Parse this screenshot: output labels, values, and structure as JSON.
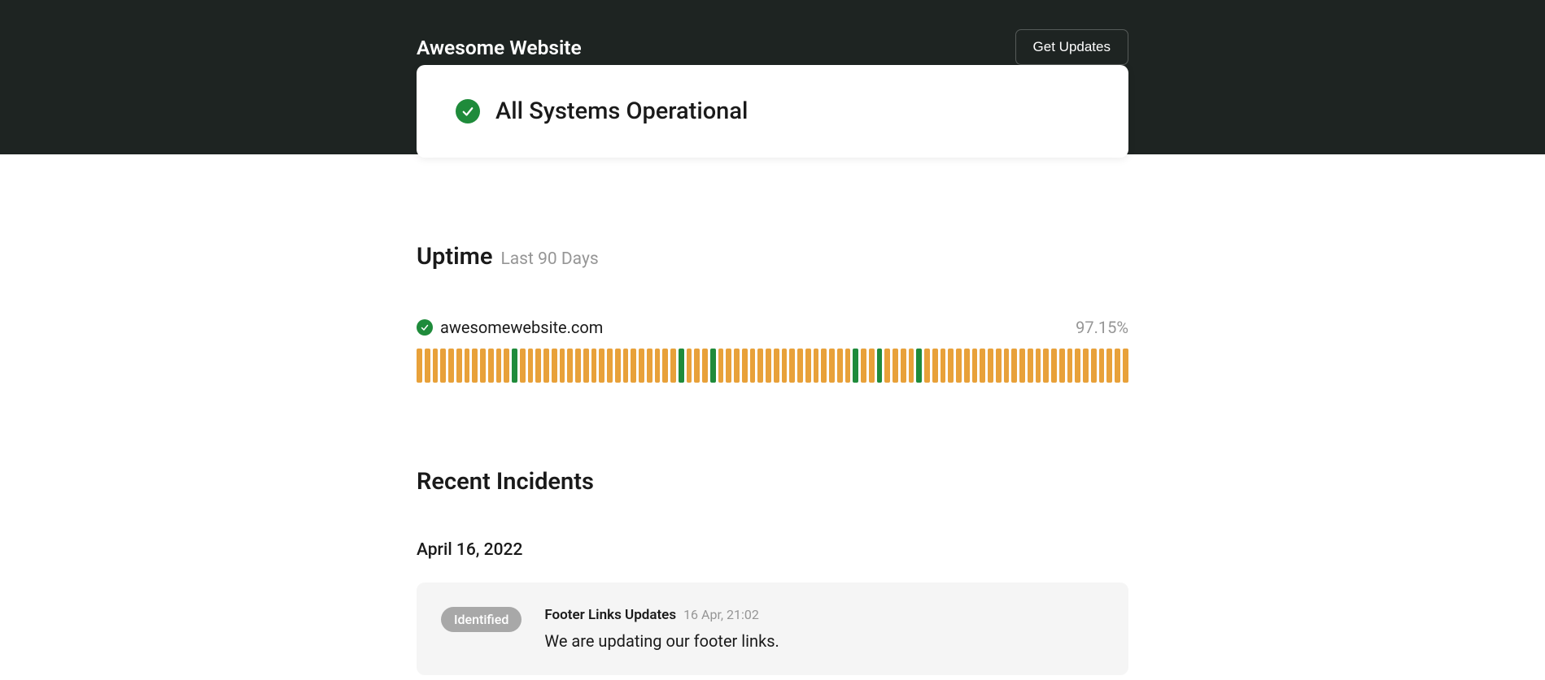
{
  "header": {
    "title": "Awesome Website",
    "updates_button": "Get Updates"
  },
  "status": {
    "message": "All Systems Operational"
  },
  "uptime": {
    "title": "Uptime",
    "subtitle": "Last 90 Days",
    "monitor_name": "awesomewebsite.com",
    "monitor_pct": "97.15%",
    "days": [
      "orange",
      "orange",
      "orange",
      "orange",
      "orange",
      "orange",
      "orange",
      "orange",
      "orange",
      "orange",
      "orange",
      "orange",
      "green",
      "orange",
      "orange",
      "orange",
      "orange",
      "orange",
      "orange",
      "orange",
      "orange",
      "orange",
      "orange",
      "orange",
      "orange",
      "orange",
      "orange",
      "orange",
      "orange",
      "orange",
      "orange",
      "orange",
      "orange",
      "green",
      "orange",
      "orange",
      "orange",
      "green",
      "orange",
      "orange",
      "orange",
      "orange",
      "orange",
      "orange",
      "orange",
      "orange",
      "orange",
      "orange",
      "orange",
      "orange",
      "orange",
      "orange",
      "orange",
      "orange",
      "orange",
      "green",
      "orange",
      "orange",
      "green",
      "orange",
      "orange",
      "orange",
      "orange",
      "green",
      "orange",
      "orange",
      "orange",
      "orange",
      "orange",
      "orange",
      "orange",
      "orange",
      "orange",
      "orange",
      "orange",
      "orange",
      "orange",
      "orange",
      "orange",
      "orange",
      "orange",
      "orange",
      "orange",
      "orange",
      "orange",
      "orange",
      "orange",
      "orange",
      "orange",
      "orange"
    ]
  },
  "incidents": {
    "title": "Recent Incidents",
    "items": [
      {
        "date": "April 16, 2022",
        "badge": "Identified",
        "title": "Footer Links Updates",
        "time": "16 Apr, 21:02",
        "description": "We are updating our footer links."
      }
    ]
  }
}
